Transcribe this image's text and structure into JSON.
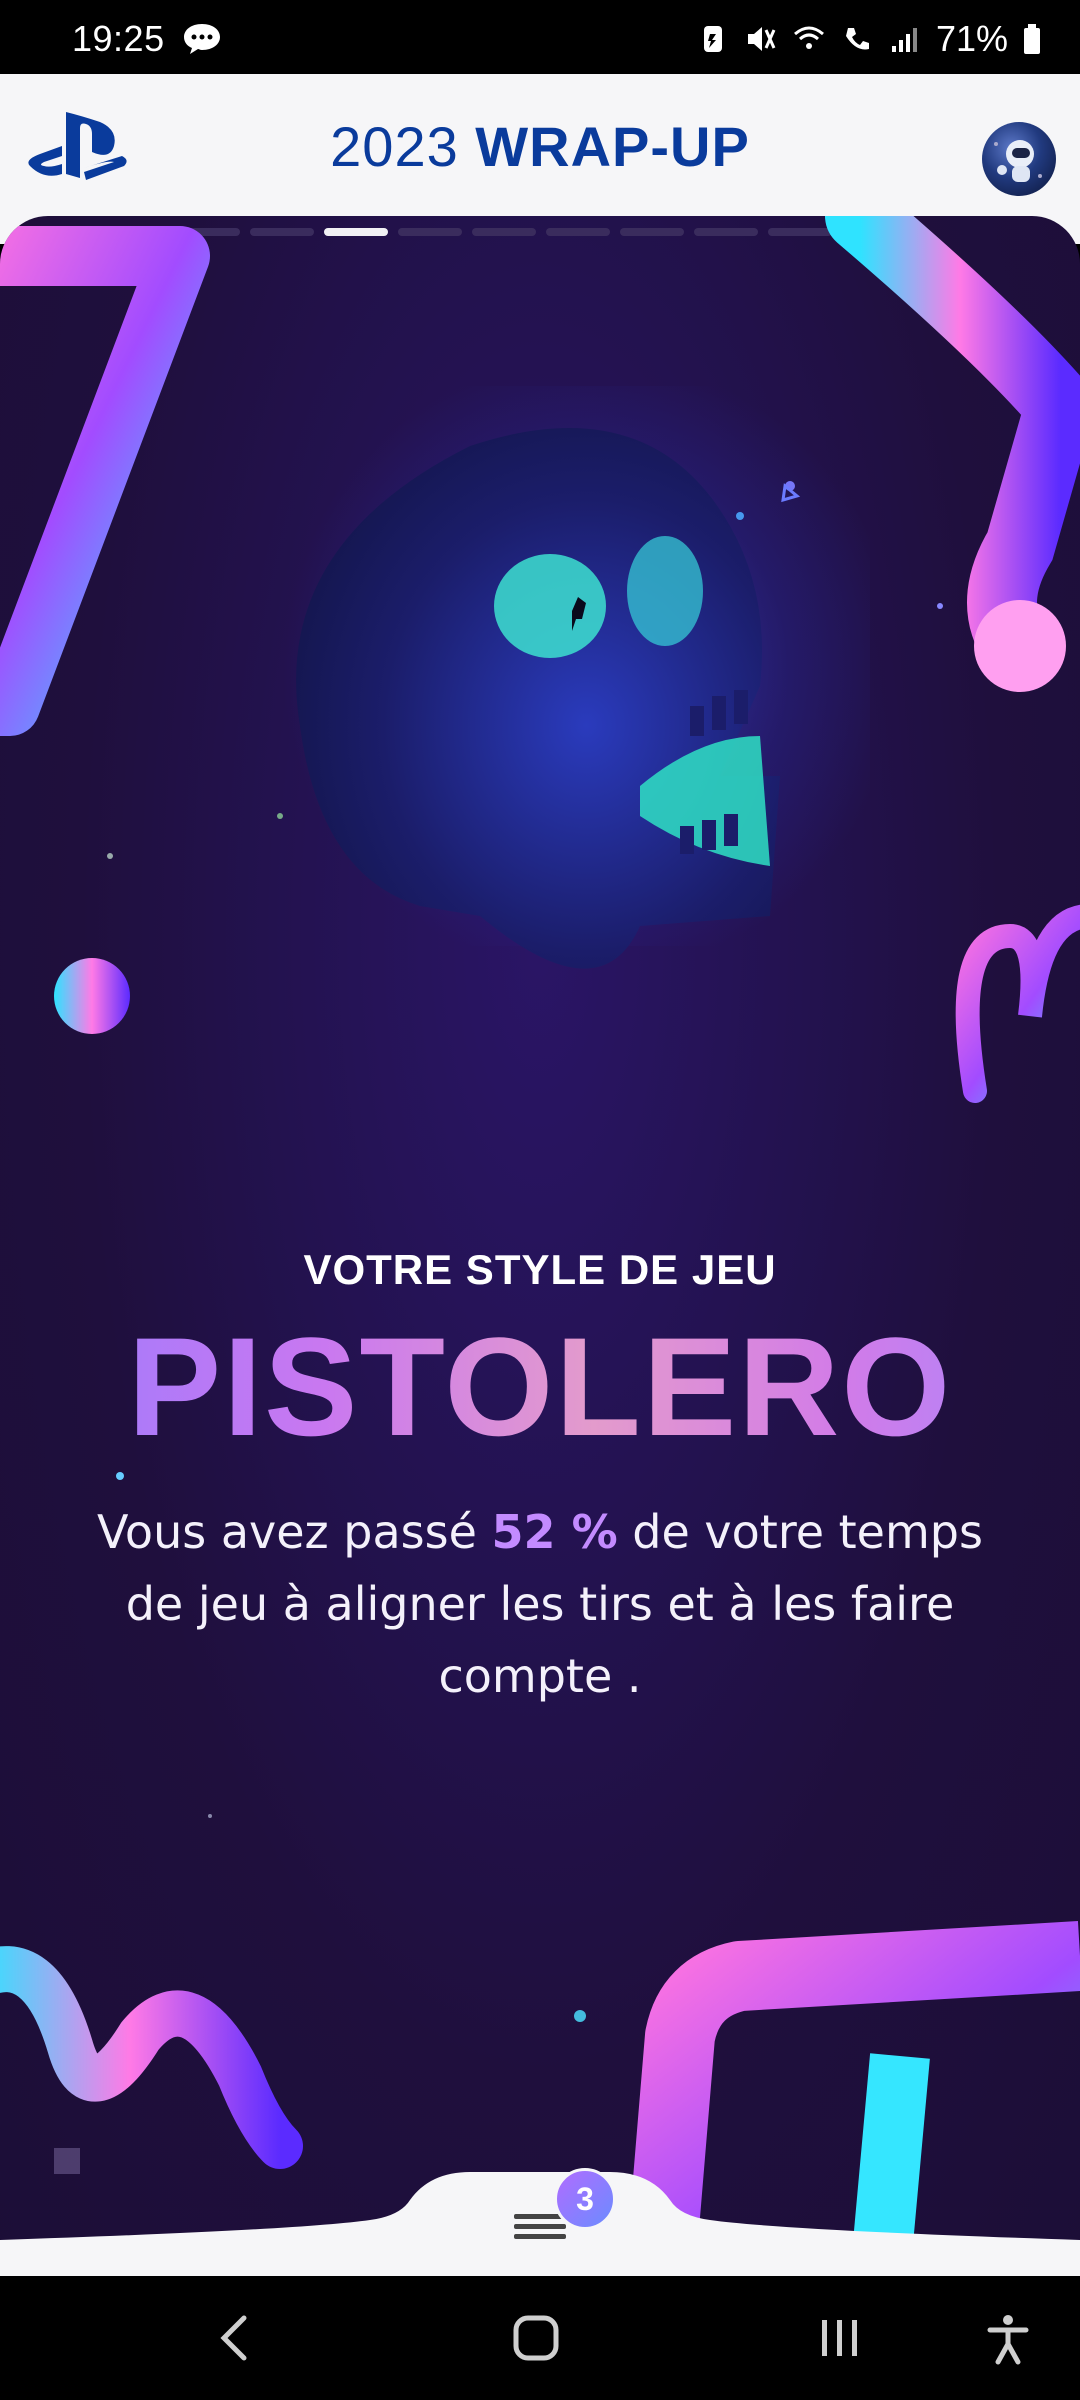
{
  "status_bar": {
    "time": "19:25",
    "battery": "71%",
    "icons": [
      "chat-icon",
      "battery-saver-icon",
      "mute-icon",
      "wifi-icon",
      "wifi-calling-icon",
      "signal-icon",
      "battery-icon"
    ]
  },
  "header": {
    "title_year": "2023",
    "title_main": "WRAP-UP",
    "logo": "playstation-logo",
    "avatar": "profile-avatar"
  },
  "story": {
    "progress_total": 10,
    "progress_current": 3
  },
  "content": {
    "eyebrow": "VOTRE STYLE DE JEU",
    "headline": "PISTOLERO",
    "desc_before": "Vous avez passé ",
    "desc_percent": "52 %",
    "desc_after": " de votre temps de jeu à aligner les tirs et à les faire compte ."
  },
  "bottom": {
    "menu_badge": "3"
  },
  "nav": {
    "buttons": [
      "back-icon",
      "home-icon",
      "recents-icon",
      "accessibility-icon"
    ]
  },
  "colors": {
    "brand_blue": "#0a3b9c",
    "accent_purple": "#c38bff",
    "background": "#1f0f3d"
  }
}
